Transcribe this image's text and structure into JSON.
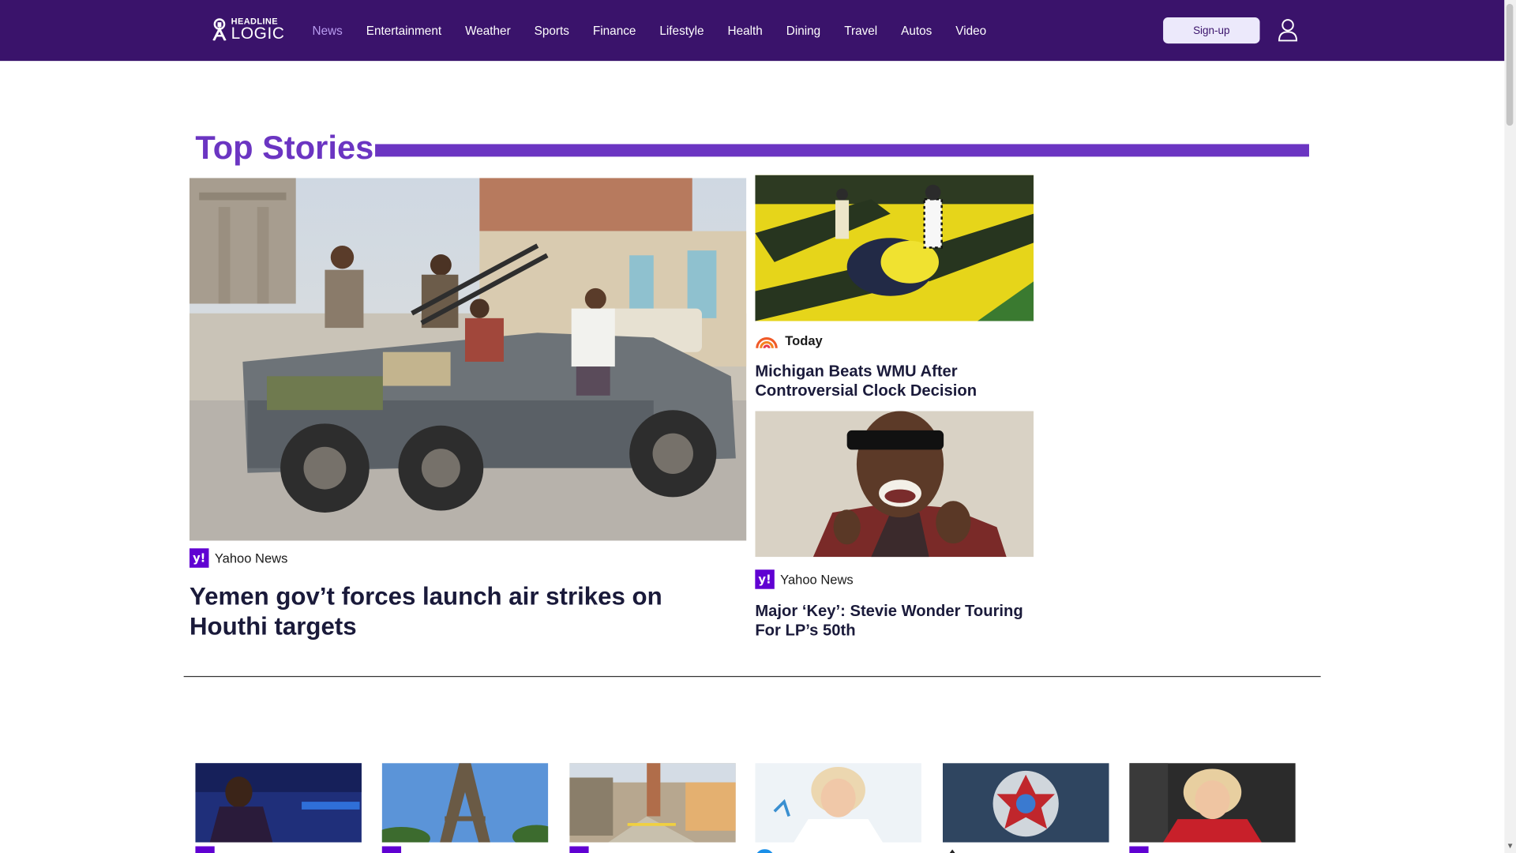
{
  "header": {
    "logo": {
      "line1": "HEADLINE",
      "line2": "LOGIC"
    },
    "nav": [
      {
        "label": "News",
        "active": true
      },
      {
        "label": "Entertainment",
        "active": false
      },
      {
        "label": "Weather",
        "active": false
      },
      {
        "label": "Sports",
        "active": false
      },
      {
        "label": "Finance",
        "active": false
      },
      {
        "label": "Lifestyle",
        "active": false
      },
      {
        "label": "Health",
        "active": false
      },
      {
        "label": "Dining",
        "active": false
      },
      {
        "label": "Travel",
        "active": false
      },
      {
        "label": "Autos",
        "active": false
      },
      {
        "label": "Video",
        "active": false
      }
    ],
    "signup_label": "Sign-up",
    "account_icon": "user-icon"
  },
  "top_stories": {
    "title": "Top Stories",
    "main": {
      "source": "Yahoo News",
      "source_icon": "yahoo-icon",
      "headline": "Yemen gov’t forces launch air strikes on Houthi targets"
    },
    "side": [
      {
        "source": "Today",
        "source_icon": "today-rainbow-icon",
        "headline": "Michigan Beats WMU After Controversial Clock Decision"
      },
      {
        "source": "Yahoo News",
        "source_icon": "yahoo-icon",
        "headline": "Major ‘Key’: Stevie Wonder Touring For LP’s 50th"
      }
    ]
  },
  "colors": {
    "header_bg": "#3a136b",
    "accent": "#6b35c2",
    "nav_active": "#b89cf0",
    "yahoo_purple": "#6001d2"
  }
}
